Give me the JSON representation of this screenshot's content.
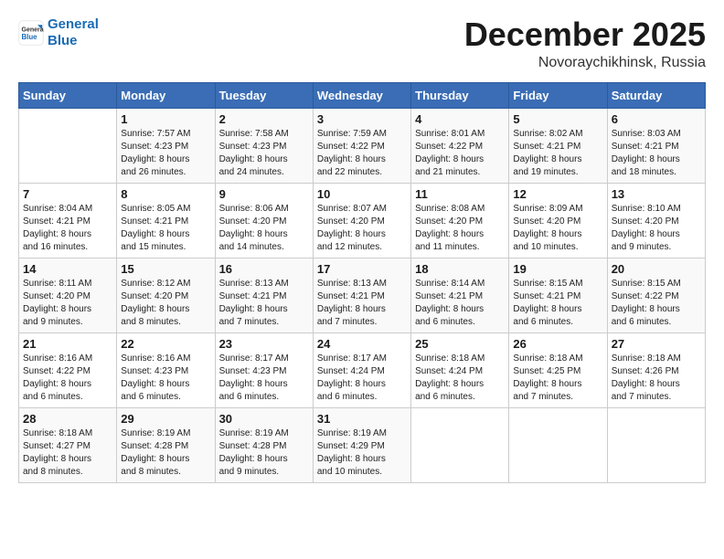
{
  "header": {
    "logo_line1": "General",
    "logo_line2": "Blue",
    "month": "December 2025",
    "location": "Novoraychikhinsk, Russia"
  },
  "weekdays": [
    "Sunday",
    "Monday",
    "Tuesday",
    "Wednesday",
    "Thursday",
    "Friday",
    "Saturday"
  ],
  "weeks": [
    [
      {
        "day": "",
        "info": ""
      },
      {
        "day": "1",
        "info": "Sunrise: 7:57 AM\nSunset: 4:23 PM\nDaylight: 8 hours\nand 26 minutes."
      },
      {
        "day": "2",
        "info": "Sunrise: 7:58 AM\nSunset: 4:23 PM\nDaylight: 8 hours\nand 24 minutes."
      },
      {
        "day": "3",
        "info": "Sunrise: 7:59 AM\nSunset: 4:22 PM\nDaylight: 8 hours\nand 22 minutes."
      },
      {
        "day": "4",
        "info": "Sunrise: 8:01 AM\nSunset: 4:22 PM\nDaylight: 8 hours\nand 21 minutes."
      },
      {
        "day": "5",
        "info": "Sunrise: 8:02 AM\nSunset: 4:21 PM\nDaylight: 8 hours\nand 19 minutes."
      },
      {
        "day": "6",
        "info": "Sunrise: 8:03 AM\nSunset: 4:21 PM\nDaylight: 8 hours\nand 18 minutes."
      }
    ],
    [
      {
        "day": "7",
        "info": "Sunrise: 8:04 AM\nSunset: 4:21 PM\nDaylight: 8 hours\nand 16 minutes."
      },
      {
        "day": "8",
        "info": "Sunrise: 8:05 AM\nSunset: 4:21 PM\nDaylight: 8 hours\nand 15 minutes."
      },
      {
        "day": "9",
        "info": "Sunrise: 8:06 AM\nSunset: 4:20 PM\nDaylight: 8 hours\nand 14 minutes."
      },
      {
        "day": "10",
        "info": "Sunrise: 8:07 AM\nSunset: 4:20 PM\nDaylight: 8 hours\nand 12 minutes."
      },
      {
        "day": "11",
        "info": "Sunrise: 8:08 AM\nSunset: 4:20 PM\nDaylight: 8 hours\nand 11 minutes."
      },
      {
        "day": "12",
        "info": "Sunrise: 8:09 AM\nSunset: 4:20 PM\nDaylight: 8 hours\nand 10 minutes."
      },
      {
        "day": "13",
        "info": "Sunrise: 8:10 AM\nSunset: 4:20 PM\nDaylight: 8 hours\nand 9 minutes."
      }
    ],
    [
      {
        "day": "14",
        "info": "Sunrise: 8:11 AM\nSunset: 4:20 PM\nDaylight: 8 hours\nand 9 minutes."
      },
      {
        "day": "15",
        "info": "Sunrise: 8:12 AM\nSunset: 4:20 PM\nDaylight: 8 hours\nand 8 minutes."
      },
      {
        "day": "16",
        "info": "Sunrise: 8:13 AM\nSunset: 4:21 PM\nDaylight: 8 hours\nand 7 minutes."
      },
      {
        "day": "17",
        "info": "Sunrise: 8:13 AM\nSunset: 4:21 PM\nDaylight: 8 hours\nand 7 minutes."
      },
      {
        "day": "18",
        "info": "Sunrise: 8:14 AM\nSunset: 4:21 PM\nDaylight: 8 hours\nand 6 minutes."
      },
      {
        "day": "19",
        "info": "Sunrise: 8:15 AM\nSunset: 4:21 PM\nDaylight: 8 hours\nand 6 minutes."
      },
      {
        "day": "20",
        "info": "Sunrise: 8:15 AM\nSunset: 4:22 PM\nDaylight: 8 hours\nand 6 minutes."
      }
    ],
    [
      {
        "day": "21",
        "info": "Sunrise: 8:16 AM\nSunset: 4:22 PM\nDaylight: 8 hours\nand 6 minutes."
      },
      {
        "day": "22",
        "info": "Sunrise: 8:16 AM\nSunset: 4:23 PM\nDaylight: 8 hours\nand 6 minutes."
      },
      {
        "day": "23",
        "info": "Sunrise: 8:17 AM\nSunset: 4:23 PM\nDaylight: 8 hours\nand 6 minutes."
      },
      {
        "day": "24",
        "info": "Sunrise: 8:17 AM\nSunset: 4:24 PM\nDaylight: 8 hours\nand 6 minutes."
      },
      {
        "day": "25",
        "info": "Sunrise: 8:18 AM\nSunset: 4:24 PM\nDaylight: 8 hours\nand 6 minutes."
      },
      {
        "day": "26",
        "info": "Sunrise: 8:18 AM\nSunset: 4:25 PM\nDaylight: 8 hours\nand 7 minutes."
      },
      {
        "day": "27",
        "info": "Sunrise: 8:18 AM\nSunset: 4:26 PM\nDaylight: 8 hours\nand 7 minutes."
      }
    ],
    [
      {
        "day": "28",
        "info": "Sunrise: 8:18 AM\nSunset: 4:27 PM\nDaylight: 8 hours\nand 8 minutes."
      },
      {
        "day": "29",
        "info": "Sunrise: 8:19 AM\nSunset: 4:28 PM\nDaylight: 8 hours\nand 8 minutes."
      },
      {
        "day": "30",
        "info": "Sunrise: 8:19 AM\nSunset: 4:28 PM\nDaylight: 8 hours\nand 9 minutes."
      },
      {
        "day": "31",
        "info": "Sunrise: 8:19 AM\nSunset: 4:29 PM\nDaylight: 8 hours\nand 10 minutes."
      },
      {
        "day": "",
        "info": ""
      },
      {
        "day": "",
        "info": ""
      },
      {
        "day": "",
        "info": ""
      }
    ]
  ]
}
